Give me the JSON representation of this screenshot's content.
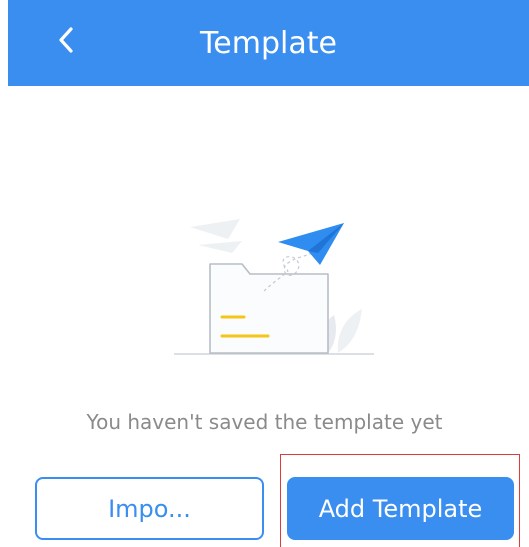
{
  "header": {
    "title": "Template",
    "back_icon": "chevron-left-icon",
    "background_color": "#3a8ef0"
  },
  "empty_state": {
    "illustration": "empty-folder-paper-plane-illustration",
    "message": "You haven't saved the template yet"
  },
  "actions": {
    "import_label": "Impo...",
    "add_label": "Add Template",
    "accent_color": "#3a8ef0",
    "highlight_color": "#e03a3a"
  }
}
